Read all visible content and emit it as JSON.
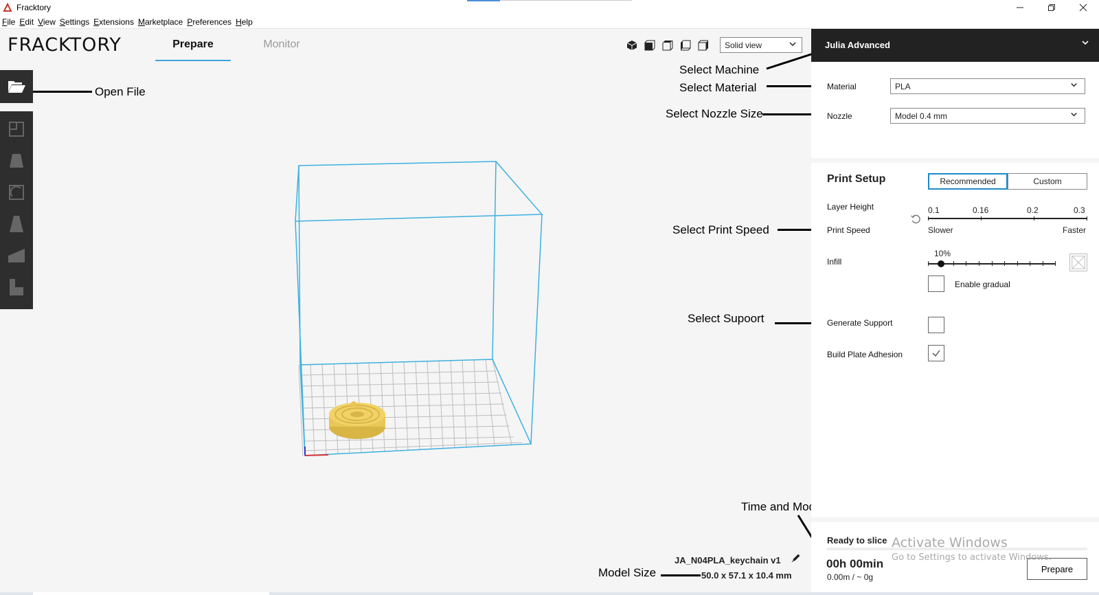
{
  "window": {
    "title": "Fracktory",
    "controls": [
      "minimize",
      "maximize",
      "close"
    ]
  },
  "menu": [
    "File",
    "Edit",
    "View",
    "Settings",
    "Extensions",
    "Marketplace",
    "Preferences",
    "Help"
  ],
  "header": {
    "logo": "FRACKTORY",
    "tabs": [
      {
        "label": "Prepare",
        "active": true
      },
      {
        "label": "Monitor",
        "active": false
      }
    ],
    "view_mode": "Solid view",
    "view_icons": [
      "3d-view-icon",
      "front-view-icon",
      "top-view-icon",
      "left-view-icon",
      "right-view-icon"
    ]
  },
  "toolbar": {
    "open_icon": "folder-open-icon",
    "tools": [
      "move-tool-icon",
      "scale-tool-icon",
      "rotate-tool-icon",
      "mirror-tool-icon",
      "per-model-settings-icon",
      "support-blocker-icon"
    ]
  },
  "machine": {
    "name": "Julia Advanced"
  },
  "material": {
    "label": "Material",
    "value": "PLA"
  },
  "nozzle": {
    "label": "Nozzle",
    "value": "Model 0.4 mm"
  },
  "print_setup": {
    "title": "Print Setup",
    "modes": [
      "Recommended",
      "Custom"
    ],
    "active_mode": "Recommended",
    "layer_height": {
      "label": "Layer Height",
      "ticks": [
        "0.1",
        "0.16",
        "0.2",
        "0.3"
      ]
    },
    "print_speed": {
      "label": "Print Speed",
      "min": "Slower",
      "max": "Faster"
    },
    "infill": {
      "label": "Infill",
      "value": "10%",
      "fraction": 0.1
    },
    "gradual": {
      "label": "Enable gradual",
      "checked": false
    },
    "support": {
      "label": "Generate Support",
      "checked": false
    },
    "adhesion": {
      "label": "Build Plate Adhesion",
      "checked": true
    }
  },
  "slice": {
    "status": "Ready to slice",
    "time": "00h 00min",
    "material_usage": "0.00m / ~ 0g",
    "button": "Prepare"
  },
  "model": {
    "name": "JA_N04PLA_keychain   v1",
    "size": "50.0 x 57.1 x 10.4 mm"
  },
  "annotations": {
    "open_file": "Open File",
    "select_machine": "Select Machine",
    "select_material": "Select Material",
    "select_nozzle": "Select Nozzle Size",
    "select_speed": "Select Print Speed",
    "select_support": "Select Supoort",
    "time_model": "Time and Model",
    "model_size": "Model Size"
  },
  "activation": {
    "title": "Activate Windows",
    "subtitle": "Go to Settings to activate Windows."
  },
  "colors": {
    "accent": "#1e8ac7",
    "build_volume": "#3cb0e0",
    "model": "#f2d266",
    "toolbar": "#2e2e2e"
  }
}
